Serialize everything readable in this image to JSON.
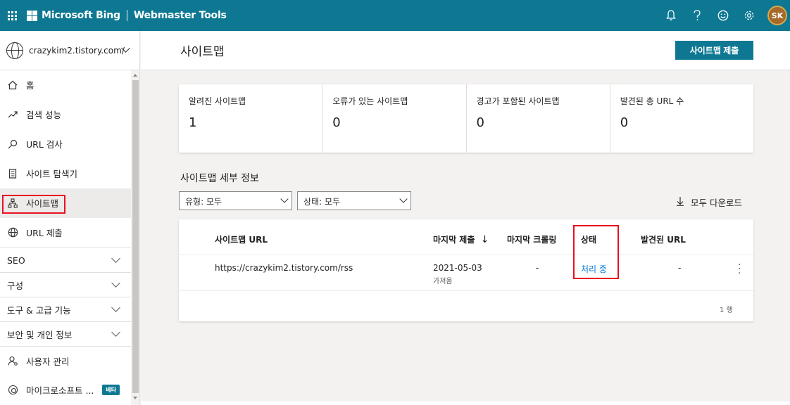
{
  "topbar": {
    "brand": "Microsoft Bing",
    "product": "Webmaster Tools",
    "icons": [
      "bell-icon",
      "help-icon",
      "feedback-smile-icon",
      "settings-gear-icon"
    ],
    "avatar_initials": "SK"
  },
  "sidebar": {
    "site": "crazykim2.tistory.com/",
    "items": [
      {
        "label": "홈",
        "icon": "home-icon"
      },
      {
        "label": "검색 성능",
        "icon": "trend-icon"
      },
      {
        "label": "URL 검사",
        "icon": "search-icon"
      },
      {
        "label": "사이트 탐색기",
        "icon": "document-icon"
      },
      {
        "label": "사이트맵",
        "icon": "sitemap-icon",
        "active": true
      },
      {
        "label": "URL 제출",
        "icon": "globe-icon"
      }
    ],
    "groups": [
      "SEO",
      "구성",
      "도구 & 고급 기능",
      "보안 및 개인 정보"
    ],
    "bottom": [
      {
        "label": "사용자 관리",
        "icon": "user-manage-icon"
      },
      {
        "label": "마이크로소프트 ...",
        "icon": "clarity-icon",
        "badge": "베타"
      }
    ]
  },
  "page": {
    "title": "사이트맵",
    "submit_button": "사이트맵 제출"
  },
  "stats": [
    {
      "label": "알려진 사이트맵",
      "value": "1"
    },
    {
      "label": "오류가 있는 사이트맵",
      "value": "0"
    },
    {
      "label": "경고가 포함된 사이트맵",
      "value": "0"
    },
    {
      "label": "발견된 총 URL 수",
      "value": "0"
    }
  ],
  "details": {
    "title": "사이트맵 세부 정보",
    "filter_type": "유형: 모두",
    "filter_status": "상태: 모두",
    "download": "모두 다운로드"
  },
  "table": {
    "headers": {
      "url": "사이트맵 URL",
      "last_submit": "마지막 제출",
      "sort_arrow": "↓",
      "last_crawl": "마지막 크롤링",
      "status": "상태",
      "found_urls": "발견된 URL"
    },
    "rows": [
      {
        "url": "https://crazykim2.tistory.com/rss",
        "last_submit": "2021-05-03",
        "last_submit_sub": "가져옴",
        "last_crawl": "-",
        "status": "처리 중",
        "found_urls": "-"
      }
    ],
    "row_count": "1 행"
  }
}
